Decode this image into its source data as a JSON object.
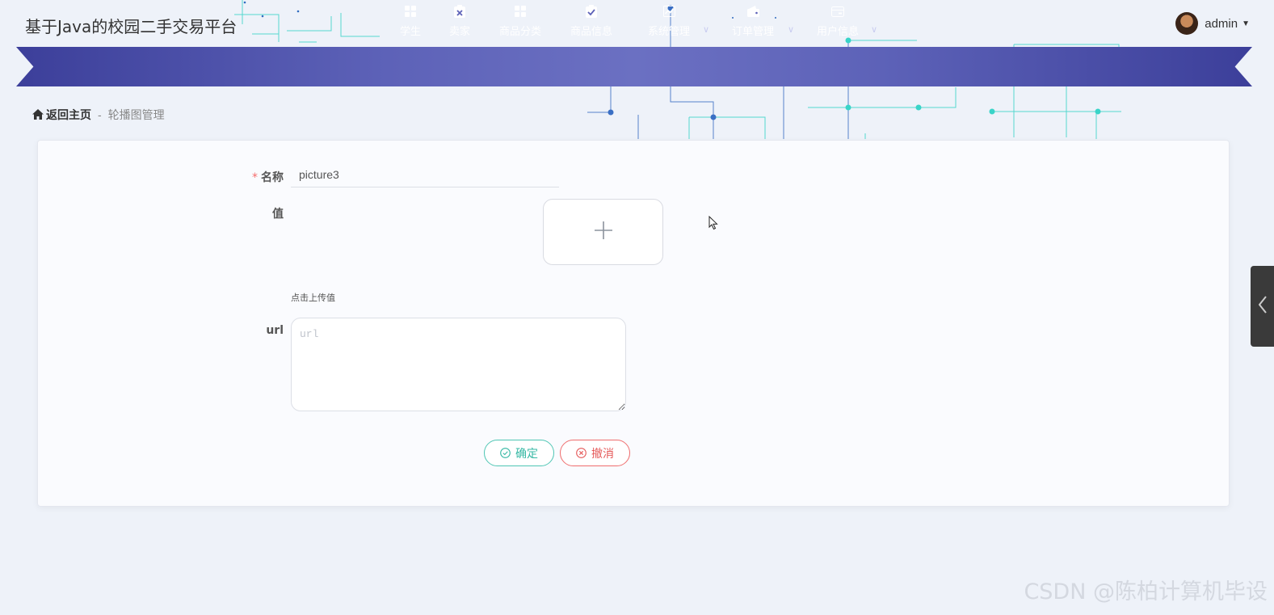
{
  "header": {
    "site_title": "基于Java的校园二手交易平台",
    "username": "admin"
  },
  "nav": {
    "items": [
      {
        "label": "学生",
        "icon": "grid-icon"
      },
      {
        "label": "卖家",
        "icon": "clipboard-x-icon"
      },
      {
        "label": "商品分类",
        "icon": "grid-icon"
      },
      {
        "label": "商品信息",
        "icon": "clipboard-check-icon"
      },
      {
        "label": "系统管理",
        "icon": "chart-icon",
        "dropdown": true
      },
      {
        "label": "订单管理",
        "icon": "wallet-icon",
        "dropdown": true
      },
      {
        "label": "用户信息",
        "icon": "card-icon",
        "dropdown": true
      }
    ]
  },
  "breadcrumb": {
    "home": "返回主页",
    "separator": "-",
    "current": "轮播图管理"
  },
  "form": {
    "name_label": "名称",
    "name_required_mark": "*",
    "name_value": "picture3",
    "value_label": "值",
    "upload_tip": "点击上传值",
    "url_label": "url",
    "url_placeholder": "url",
    "url_value": "",
    "confirm_label": "确定",
    "cancel_label": "撤消"
  },
  "watermark": "CSDN @陈柏计算机毕设",
  "colors": {
    "nav_bg": "#5d62b8",
    "confirm": "#36b8a4",
    "cancel": "#e55a5a",
    "required": "#f56c6c"
  }
}
